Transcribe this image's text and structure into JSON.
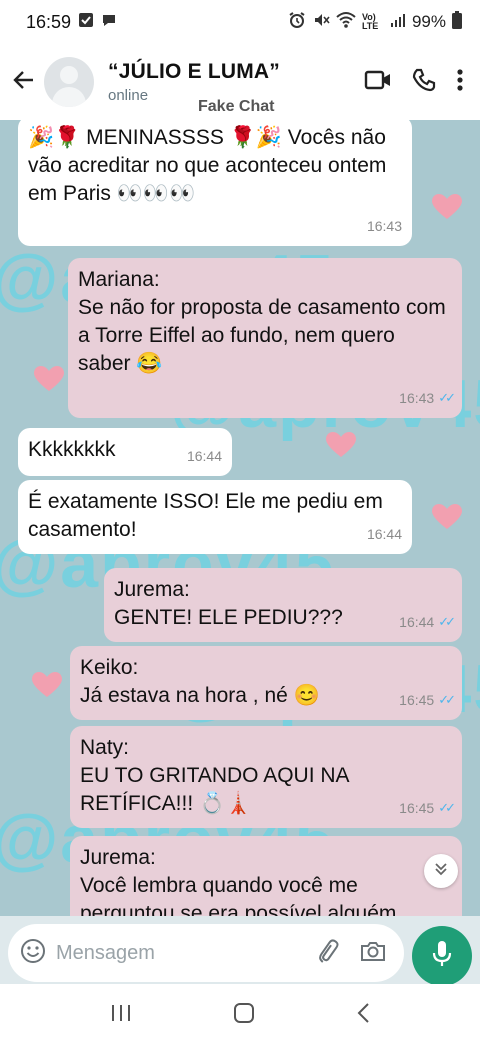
{
  "status_bar": {
    "time": "16:59",
    "battery": "99%",
    "network": "Vo) LTE"
  },
  "header": {
    "contact_name": "“JÚLIO E LUMA”",
    "contact_status": "online",
    "overlay_label": "Fake Chat"
  },
  "watermark": "@aprov45",
  "messages": [
    {
      "direction": "in",
      "sender": "",
      "text": "🎉🌹 MENINASSSS 🌹🎉 Vocês não vão acreditar no que aconteceu ontem em Paris 👀👀👀",
      "time": "16:43",
      "read": false
    },
    {
      "direction": "out",
      "sender": "Mariana:",
      "text": "Se não for proposta de casamento com a Torre Eiffel ao fundo, nem quero saber 😂",
      "time": "16:43",
      "read": true
    },
    {
      "direction": "in",
      "sender": "",
      "text": "Kkkkkkkk",
      "time": "16:44",
      "read": false
    },
    {
      "direction": "in",
      "sender": "",
      "text": "É exatamente ISSO! Ele me pediu em casamento!",
      "time": "16:44",
      "read": false
    },
    {
      "direction": "out",
      "sender": "Jurema:",
      "text": "GENTE! ELE PEDIU???",
      "time": "16:44",
      "read": true
    },
    {
      "direction": "out",
      "sender": "Keiko:",
      "text": "Já estava na hora , né 😊",
      "time": "16:45",
      "read": true
    },
    {
      "direction": "out",
      "sender": "Naty:",
      "text": "EU TO GRITANDO AQUI NA RETÍFICA!!! 💍🗼",
      "time": "16:45",
      "read": true
    },
    {
      "direction": "out",
      "sender": "Jurema:",
      "text": "Você lembra quando você me perguntou se era possível alguém",
      "time": "",
      "read": false
    }
  ],
  "input": {
    "placeholder": "Mensagem"
  },
  "colors": {
    "outgoing_bubble": "#e8cfd8",
    "incoming_bubble": "#ffffff",
    "mic_button": "#1f9e77",
    "read_ticks": "#4fb6ec",
    "watermark": "#69d3e3",
    "hearts": "#f2a0b0"
  },
  "icons": {
    "header": [
      "back-arrow-icon",
      "video-call-icon",
      "phone-icon",
      "more-vert-icon"
    ],
    "input": [
      "emoji-icon",
      "attach-icon",
      "camera-icon",
      "mic-icon"
    ],
    "nav": [
      "recent-apps-icon",
      "home-icon",
      "back-icon"
    ]
  }
}
